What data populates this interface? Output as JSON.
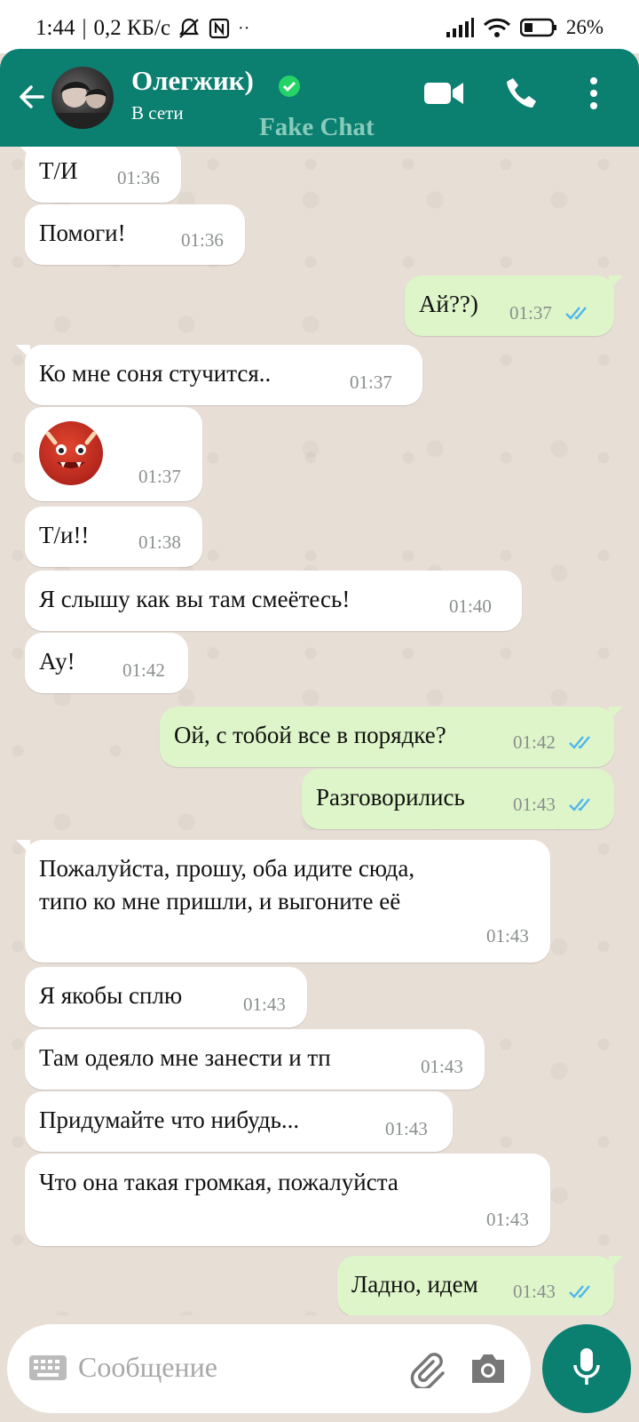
{
  "status_bar": {
    "time": "1:44",
    "speed": "0,2 КБ/с",
    "battery": "26%",
    "icons": [
      "mute-bell-icon",
      "nfc-icon",
      "signal-icon",
      "wifi-icon",
      "battery-icon"
    ]
  },
  "header": {
    "name": "Олегжик)",
    "status": "В сети",
    "watermark": "Fake Chat",
    "accent": "#0b7f70",
    "icons": [
      "back-arrow-icon",
      "verified-icon",
      "video-call-icon",
      "phone-icon",
      "menu-dots-icon"
    ]
  },
  "messages": [
    {
      "dir": "in",
      "text": "Т/И",
      "time": "01:36"
    },
    {
      "dir": "in",
      "text": "Помоги!",
      "time": "01:36"
    },
    {
      "dir": "out",
      "text": "Ай??)",
      "time": "01:37",
      "read": true
    },
    {
      "dir": "in",
      "text": "Ко мне соня стучится..",
      "time": "01:37"
    },
    {
      "dir": "in",
      "text": "",
      "emoji": "ogre-emoji",
      "time": "01:37"
    },
    {
      "dir": "in",
      "text": "Т/и!!",
      "time": "01:38"
    },
    {
      "dir": "in",
      "text": "Я слышу как вы  там смеётесь!",
      "time": "01:40"
    },
    {
      "dir": "in",
      "text": "Ау!",
      "time": "01:42"
    },
    {
      "dir": "out",
      "text": "Ой, с тобой все в порядке?",
      "time": "01:42",
      "read": true
    },
    {
      "dir": "out",
      "text": "Разговорились",
      "time": "01:43",
      "read": true
    },
    {
      "dir": "in",
      "text": "Пожалуйста, прошу, оба идите сюда,\nтипо ко мне пришли, и выгоните её",
      "time": "01:43"
    },
    {
      "dir": "in",
      "text": "Я якобы сплю",
      "time": "01:43"
    },
    {
      "dir": "in",
      "text": "Там одеяло мне занести и тп",
      "time": "01:43"
    },
    {
      "dir": "in",
      "text": "Придумайте что нибудь...",
      "time": "01:43"
    },
    {
      "dir": "in",
      "text": "Что она такая громкая, пожалуйста",
      "time": "01:43"
    },
    {
      "dir": "out",
      "text": "Ладно, идем",
      "time": "01:43",
      "read": true
    }
  ],
  "input": {
    "placeholder": "Сообщение",
    "icons": [
      "keyboard-icon",
      "attach-icon",
      "camera-icon",
      "mic-icon"
    ]
  }
}
